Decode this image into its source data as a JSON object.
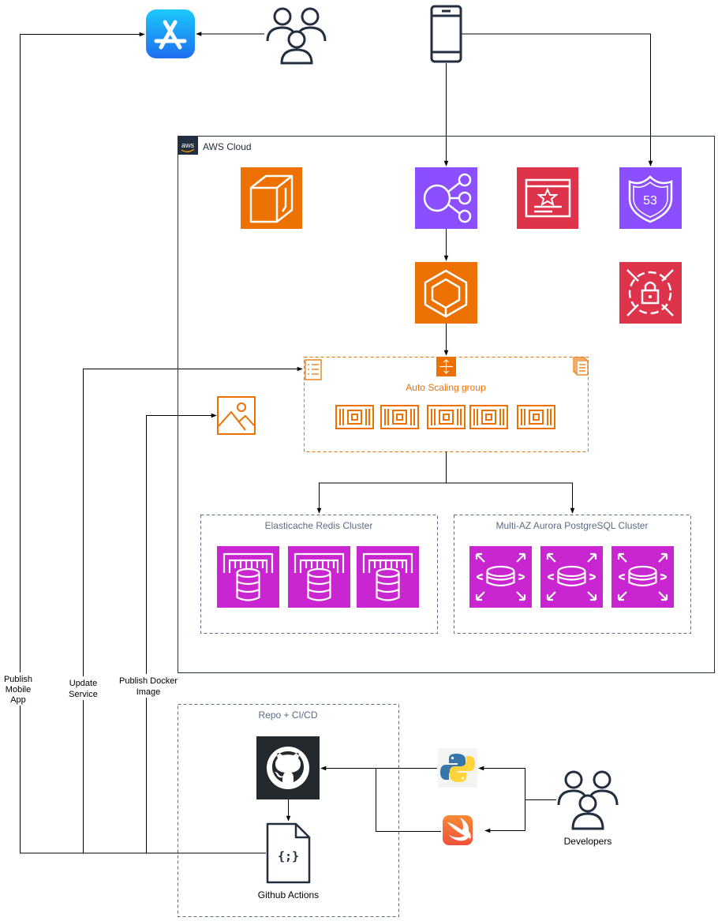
{
  "cloud": {
    "label": "AWS Cloud",
    "badge": "aws"
  },
  "asg": {
    "label": "Auto Scaling group"
  },
  "redis": {
    "label": "Elasticache Redis Cluster"
  },
  "aurora": {
    "label": "Multi-AZ Aurora PostgreSQL Cluster"
  },
  "repo": {
    "label": "Repo + CI/CD"
  },
  "route53": {
    "label": "53"
  },
  "github_actions": {
    "label": "Github Actions"
  },
  "developers": {
    "label": "Developers"
  },
  "edges": {
    "publish_mobile": [
      "Publish",
      "Mobile",
      "App"
    ],
    "update_service": [
      "Update",
      "Service"
    ],
    "publish_docker": [
      "Publish Docker",
      "Image"
    ]
  },
  "colors": {
    "compute": "#ED7100",
    "networking": "#8C4FFF",
    "security": "#DD344C",
    "database": "#C925D1",
    "app_store": "#1E88F5",
    "github": "#24292E",
    "line": "#000000",
    "group_border": "#5A6B86",
    "group_text": "#5A6B86"
  },
  "icons": {
    "app_store": "app-store-icon",
    "users": "users-icon",
    "mobile_client": "mobile-phone-icon",
    "lightsail": "lightsail-icon",
    "load_balancer": "elastic-load-balancer-icon",
    "certificate": "certificate-manager-icon",
    "route53": "route53-icon",
    "ecs": "ecs-icon",
    "shield": "shield-icon",
    "image": "image-icon",
    "ec2_instance": "ec2-instance-icon",
    "elasticache": "elasticache-icon",
    "aurora": "aurora-icon",
    "github": "github-icon",
    "python": "python-icon",
    "swift": "swift-icon",
    "workflow_file": "workflow-file-icon",
    "developers": "developers-icon"
  }
}
